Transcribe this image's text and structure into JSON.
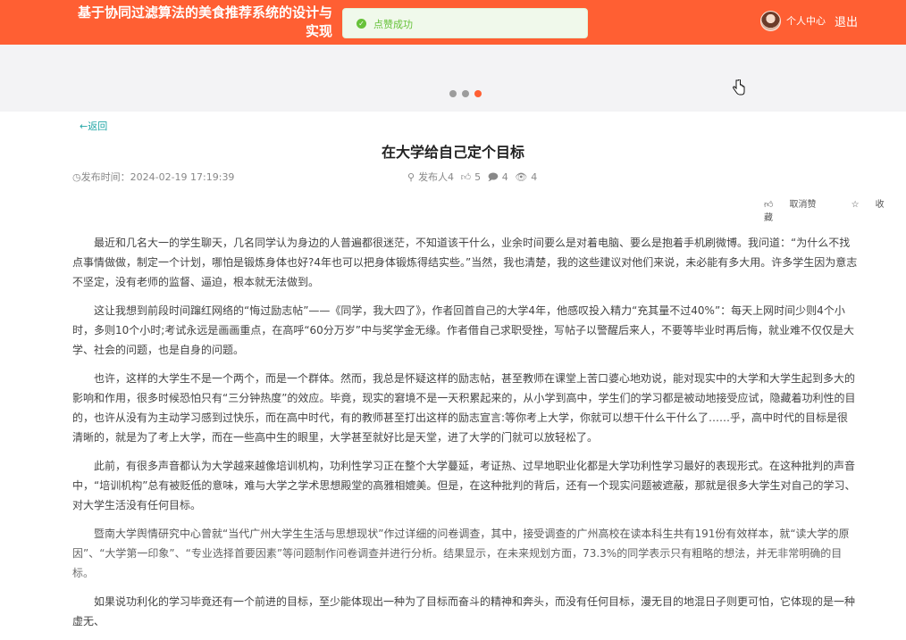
{
  "header": {
    "site_title": "基于协同过滤算法的美食推荐系统的设计与实现",
    "user_center": "个人中心",
    "logout": "退出"
  },
  "toast": {
    "text": "点赞成功",
    "color": "#67c23a"
  },
  "colors": {
    "brand": "#ff5f33",
    "link": "#22a6a6"
  },
  "banner": {
    "dots": 3,
    "active_dot": 3
  },
  "article": {
    "back": "←返回",
    "title": "在大学给自己定个目标",
    "publish_time": "发布时间：2024-02-19 17:19:39",
    "publisher": "发布人4",
    "likes": "5",
    "comments": "4",
    "views": "4",
    "unlike": "取消赞",
    "favorite": "收藏",
    "paragraphs": [
      "最近和几名大一的学生聊天，几名同学认为身边的人普遍都很迷茫，不知道该干什么，业余时间要么是对着电脑、要么是抱着手机刷微博。我问道：“为什么不找点事情做做，制定一个计划，哪怕是锻炼身体也好?4年也可以把身体锻炼得结实些。”当然，我也清楚，我的这些建议对他们来说，未必能有多大用。许多学生因为意志不坚定，没有老师的监督、逼迫，根本就无法做到。",
      "这让我想到前段时间蹿红网络的“悔过励志帖”——《同学，我大四了》，作者回首自己的大学4年，他感叹投入精力“充其量不过40%”：每天上网时间少则4个小时，多则10个小时;考试永远是画画重点，在高呼“60分万岁”中与奖学金无缘。作者借自己求职受挫，写帖子以警醒后来人，不要等毕业时再后悔，就业难不仅仅是大学、社会的问题，也是自身的问题。",
      "也许，这样的大学生不是一个两个，而是一个群体。然而，我总是怀疑这样的励志帖，甚至教师在课堂上苦口婆心地劝说，能对现实中的大学和大学生起到多大的影响和作用，很多时候恐怕只有“三分钟热度”的效应。毕竟，现实的窘境不是一天积累起来的，从小学到高中，学生们的学习都是被动地接受应试，隐藏着功利性的目的，也许从没有为主动学习感到过快乐，而在高中时代，有的教师甚至打出这样的励志宣言:等你考上大学，你就可以想干什么干什么了……乎，高中时代的目标是很清晰的，就是为了考上大学，而在一些高中生的眼里，大学甚至就好比是天堂，进了大学的门就可以放轻松了。",
      "此前，有很多声音都认为大学越来越像培训机构，功利性学习正在整个大学蔓延，考证热、过早地职业化都是大学功利性学习最好的表现形式。在这种批判的声音中，“培训机构”总有被贬低的意味，难与大学之学术思想殿堂的高雅相媲美。但是，在这种批判的背后，还有一个现实问题被遮蔽，那就是很多大学生对自己的学习、对大学生活没有任何目标。",
      "暨南大学舆情研究中心曾就“当代广州大学生生活与思想现状”作过详细的问卷调查，其中，接受调查的广州高校在读本科生共有191份有效样本，就“读大学的原因”、“大学第一印象”、“专业选择首要因素”等问题制作问卷调查并进行分析。结果显示，在未来规划方面，73.3%的同学表示只有粗略的想法，并无非常明确的目标。",
      "如果说功利化的学习毕竟还有一个前进的目标，至少能体现出一种为了目标而奋斗的精神和奔头，而没有任何目标，漫无目的地混日子则更可怕，它体现的是一种虚无、"
    ]
  }
}
